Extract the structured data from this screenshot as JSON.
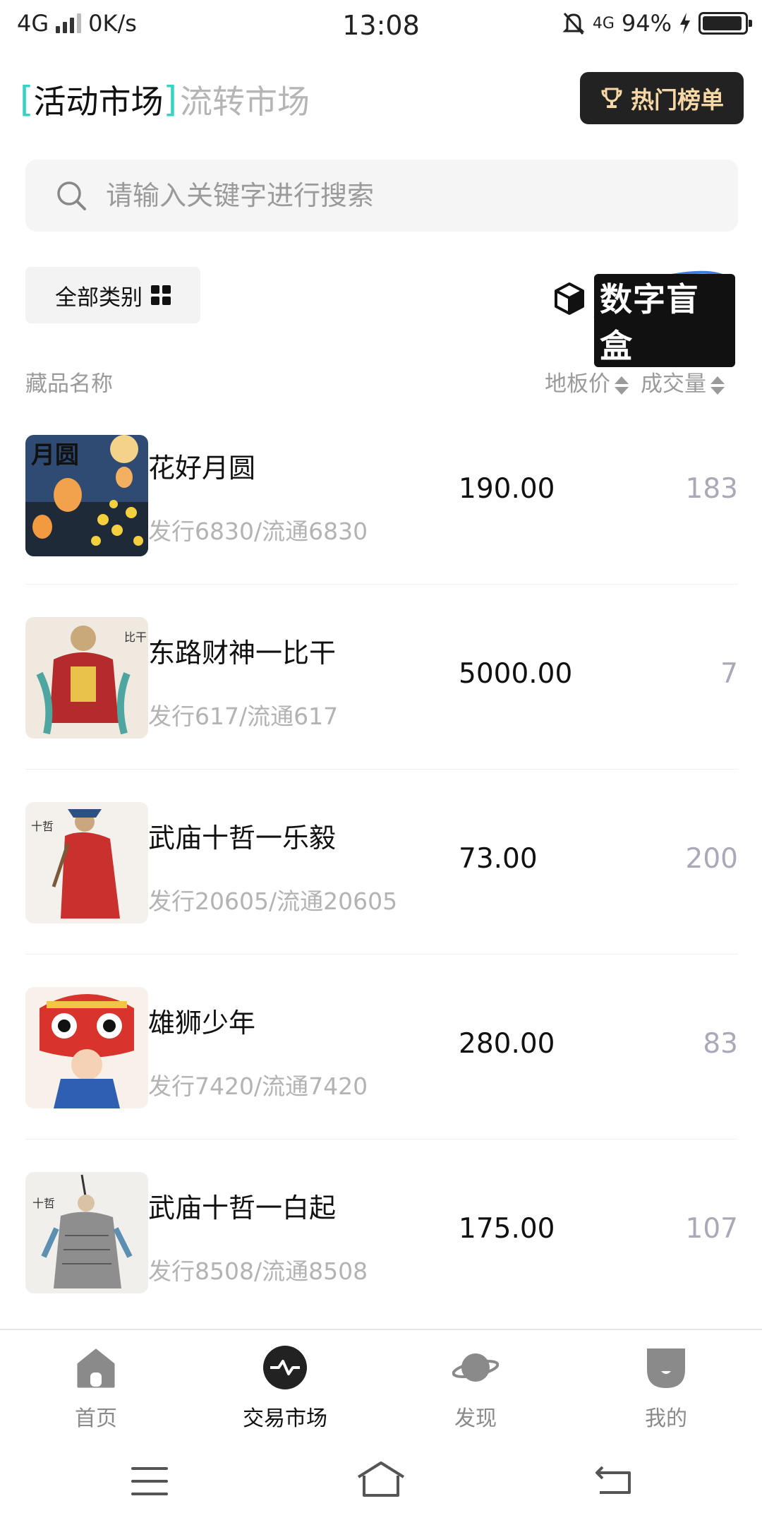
{
  "status": {
    "network": "4G",
    "speed": "0K/s",
    "time": "13:08",
    "net_small": "4G",
    "battery": "94%",
    "battery_level": 0.94
  },
  "header": {
    "tab_active": "活动市场",
    "tab_inactive": "流转市场",
    "hot_button": "热门榜单"
  },
  "search": {
    "placeholder": "请输入关键字进行搜索"
  },
  "filters": {
    "category_label": "全部类别",
    "blindbox_label": "数字盲盒"
  },
  "columns": {
    "name": "藏品名称",
    "floor_price": "地板价",
    "volume": "成交量"
  },
  "items": [
    {
      "name": "花好月圆",
      "sub": "发行6830/流通6830",
      "price": "190.00",
      "volume": "183"
    },
    {
      "name": "东路财神一比干",
      "sub": "发行617/流通617",
      "price": "5000.00",
      "volume": "7"
    },
    {
      "name": "武庙十哲一乐毅",
      "sub": "发行20605/流通20605",
      "price": "73.00",
      "volume": "200"
    },
    {
      "name": "雄狮少年",
      "sub": "发行7420/流通7420",
      "price": "280.00",
      "volume": "83"
    },
    {
      "name": "武庙十哲一白起",
      "sub": "发行8508/流通8508",
      "price": "175.00",
      "volume": "107"
    }
  ],
  "nav": {
    "home": "首页",
    "market": "交易市场",
    "discover": "发现",
    "mine": "我的"
  },
  "colors": {
    "accent": "#34d3c4",
    "hot_button_bg": "#222222",
    "hot_button_text": "#f6d8a6",
    "volume_text": "#a9a9b8"
  }
}
